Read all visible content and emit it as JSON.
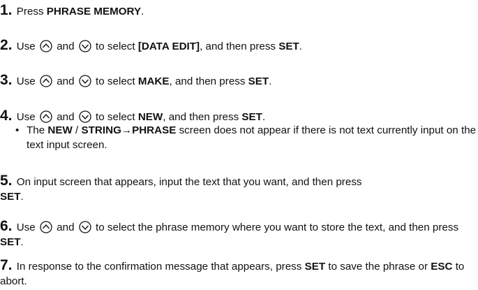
{
  "steps": [
    {
      "num": "1.",
      "t1": "Press ",
      "b1": "PHRASE MEMORY",
      "t2": "."
    },
    {
      "num": "2.",
      "use": "Use",
      "and": "and",
      "t1": " to select ",
      "b1": "[DATA EDIT]",
      "t2": ", and then press ",
      "b2": "SET",
      "t3": "."
    },
    {
      "num": "3.",
      "use": "Use",
      "and": "and",
      "t1": " to select ",
      "b1": "MAKE",
      "t2": ", and then press ",
      "b2": "SET",
      "t3": "."
    },
    {
      "num": "4.",
      "use": "Use",
      "and": "and",
      "t1": " to select ",
      "b1": "NEW",
      "t2": ", and then press ",
      "b2": "SET",
      "t3": ".",
      "note": {
        "bullet": "•",
        "t1": "The ",
        "b1": "NEW",
        "t2": " / ",
        "b2": "STRING→PHRASE",
        "t3": " screen does not appear if there is not text currently input on the text input screen."
      }
    },
    {
      "num": "5.",
      "t1": "On input screen that appears, input the text that you want, and then press ",
      "b1": "SET",
      "t2": "."
    },
    {
      "num": "6.",
      "use": "Use",
      "and": "and",
      "t1": " to select the phrase memory where you want to store the text, and then press ",
      "b1": "SET",
      "t2": "."
    },
    {
      "num": "7.",
      "t1": "In response to the confirmation message that appears, press ",
      "b1": "SET",
      "t2": " to save the phrase or ",
      "b2": "ESC",
      "t3": " to abort."
    }
  ],
  "icons": {
    "up": "up-arrow-circle-icon",
    "down": "down-arrow-circle-icon"
  }
}
